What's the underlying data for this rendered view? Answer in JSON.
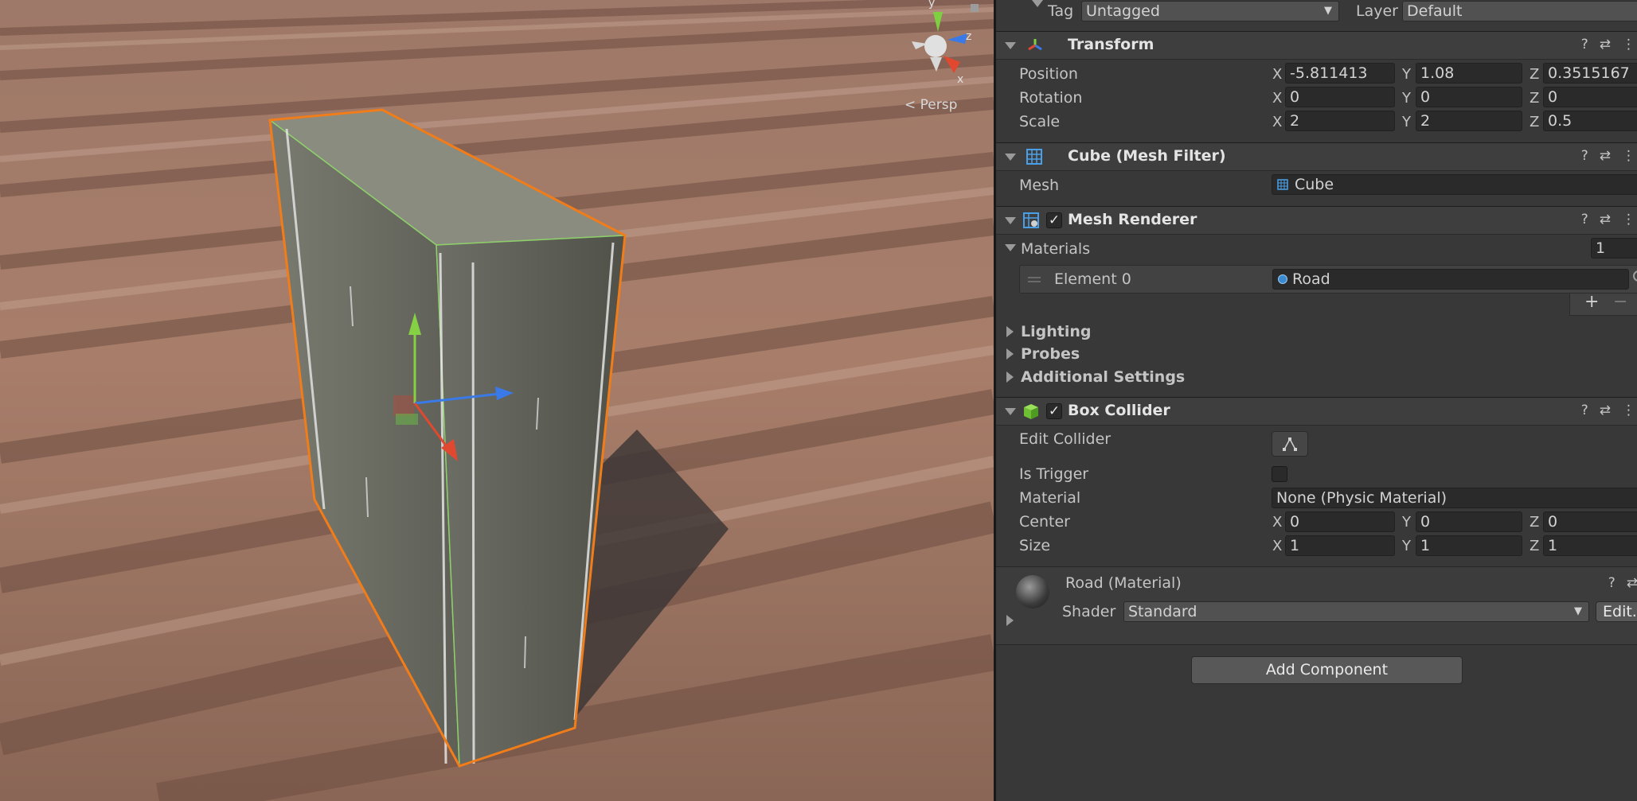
{
  "scene_view": {
    "persp_label": "< Persp",
    "gizmo_axes": {
      "x": "x",
      "y": "y",
      "z": "z"
    }
  },
  "inspector": {
    "top": {
      "tag_label": "Tag",
      "tag_value": "Untagged",
      "layer_label": "Layer",
      "layer_value": "Default"
    },
    "transform": {
      "title": "Transform",
      "position": {
        "label": "Position",
        "x": "-5.811413",
        "y": "1.08",
        "z": "0.3515167"
      },
      "rotation": {
        "label": "Rotation",
        "x": "0",
        "y": "0",
        "z": "0"
      },
      "scale": {
        "label": "Scale",
        "x": "2",
        "y": "2",
        "z": "0.5"
      }
    },
    "mesh_filter": {
      "title": "Cube (Mesh Filter)",
      "mesh_label": "Mesh",
      "mesh_value": "Cube"
    },
    "mesh_renderer": {
      "title": "Mesh Renderer",
      "materials_label": "Materials",
      "materials_count": "1",
      "element_label": "Element 0",
      "element_value": "Road",
      "add": "+",
      "remove": "−",
      "lighting": "Lighting",
      "probes": "Probes",
      "additional": "Additional Settings"
    },
    "box_collider": {
      "title": "Box Collider",
      "edit_collider": "Edit Collider",
      "is_trigger": "Is Trigger",
      "material_label": "Material",
      "material_value": "None (Physic Material)",
      "center": {
        "label": "Center",
        "x": "0",
        "y": "0",
        "z": "0"
      },
      "size": {
        "label": "Size",
        "x": "1",
        "y": "1",
        "z": "1"
      }
    },
    "material": {
      "title": "Road (Material)",
      "shader_label": "Shader",
      "shader_value": "Standard",
      "edit_label": "Edit..."
    },
    "add_component": "Add Component",
    "axis_labels": {
      "x": "X",
      "y": "Y",
      "z": "Z"
    }
  }
}
